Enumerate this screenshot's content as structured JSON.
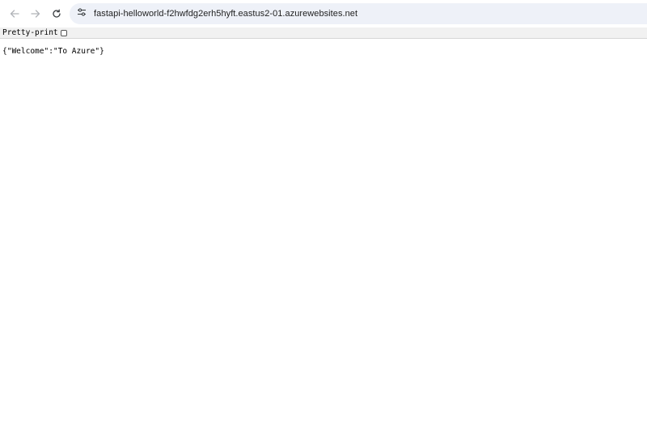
{
  "browser": {
    "url": "fastapi-helloworld-f2hwfdg2erh5hyft.eastus2-01.azurewebsites.net",
    "icons": {
      "back": "arrow-left-icon",
      "forward": "arrow-right-icon",
      "reload": "reload-icon",
      "site_info": "tune-icon"
    },
    "accent_color": "#eef1f8"
  },
  "json_viewer": {
    "pretty_print_label": "Pretty-print",
    "pretty_print_checked": false
  },
  "body": {
    "raw_json": "{\"Welcome\":\"To Azure\"}"
  }
}
